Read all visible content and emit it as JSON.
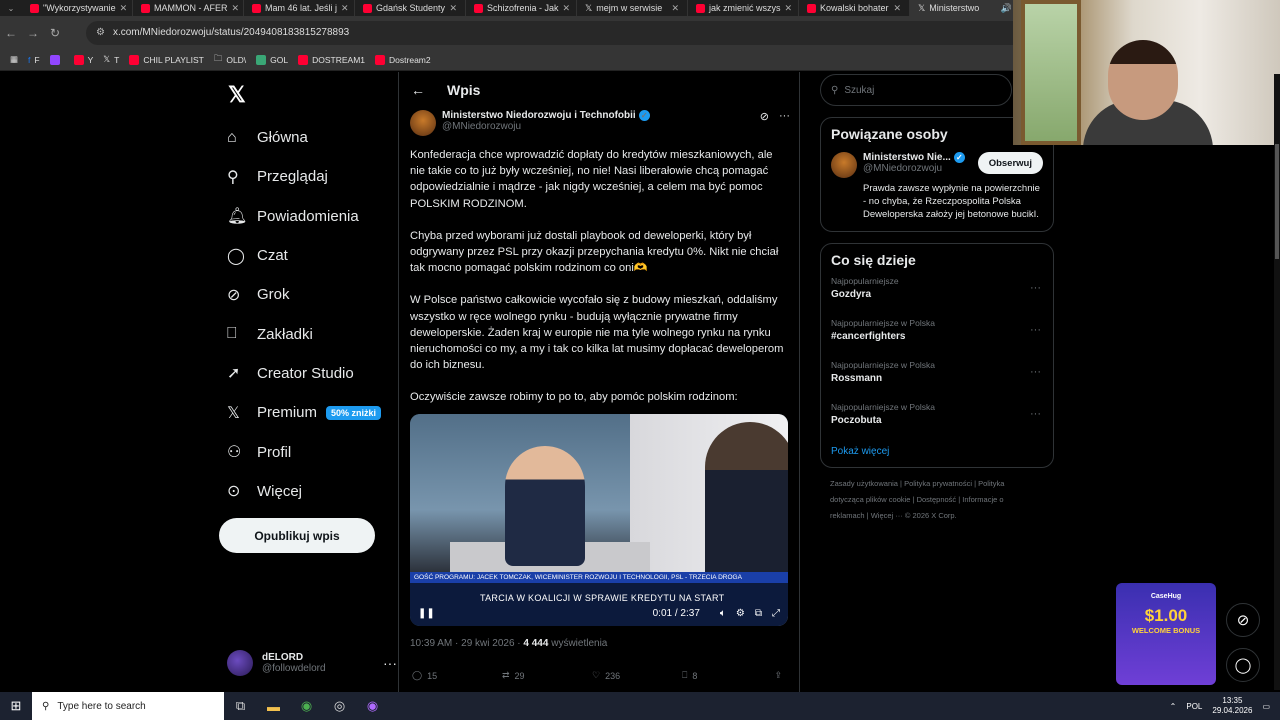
{
  "browser": {
    "tabs": [
      {
        "title": "\"Wykorzystywanie"
      },
      {
        "title": "MAMMON - AFER"
      },
      {
        "title": "Mam 46 lat. Jeśli j"
      },
      {
        "title": "Gdańsk Studenty"
      },
      {
        "title": "Schizofrenia - Jak"
      },
      {
        "title": "mejm w serwisie"
      },
      {
        "title": "jak zmienić wszys"
      },
      {
        "title": "Kowalski bohater"
      },
      {
        "title": "Ministerstwo"
      }
    ],
    "url": "x.com/MNiedorozwoju/status/2049408183815278893",
    "bookmarks": [
      "F",
      "",
      "Y",
      "T",
      "CHIL PLAYLIST",
      "OLD\\",
      "GOL",
      "DOSTREAM1",
      "Dostream2"
    ]
  },
  "sidebar": {
    "items": [
      {
        "label": "Główna"
      },
      {
        "label": "Przeglądaj"
      },
      {
        "label": "Powiadomienia"
      },
      {
        "label": "Czat"
      },
      {
        "label": "Grok"
      },
      {
        "label": "Zakładki"
      },
      {
        "label": "Creator Studio"
      },
      {
        "label": "Premium"
      },
      {
        "label": "Profil"
      },
      {
        "label": "Więcej"
      }
    ],
    "premium_badge": "50% zniżki",
    "post_button": "Opublikuj wpis",
    "account": {
      "name": "dELORD",
      "handle": "@followdelord"
    }
  },
  "post": {
    "header": "Wpis",
    "author_name": "Ministerstwo Niedorozwoju i Technofobii",
    "author_handle": "@MNiedorozwoju",
    "paragraphs": [
      "Konfederacja chce wprowadzić dopłaty do kredytów mieszkaniowych, ale nie takie co to już były wcześniej, no nie! Nasi liberałowie chcą pomagać odpowiedzialnie i mądrze - jak nigdy wcześniej, a celem ma być pomoc POLSKIM RODZINOM.",
      "Chyba przed wyborami już dostali playbook od deweloperki, który był odgrywany przez PSL przy okazji przepychania kredytu 0%. Nikt nie chciał tak mocno pomagać polskim rodzinom co oni🫶",
      "W Polsce państwo całkowicie wycofało się z budowy mieszkań, oddaliśmy wszystko w ręce wolnego rynku - budują wyłącznie prywatne firmy deweloperskie. Żaden kraj w europie nie ma tyle wolnego rynku na rynku nieruchomości co my, a my i tak co kilka lat musimy dopłacać deweloperom do ich biznesu.",
      "Oczywiście zawsze robimy to po to, aby pomóc polskim rodzinom:"
    ],
    "video": {
      "chyron": "GOŚĆ PROGRAMU: JACEK TOMCZAK, WICEMINISTER ROZWOJU I TECHNOLOGII, PSL - TRZECIA DROGA",
      "ticker": "TARCIA W KOALICJI W SPRAWIE KREDYTU NA START",
      "time": "0:01 / 2:37"
    },
    "meta_time": "10:39 AM · 29 kwi 2026 · ",
    "views": "4 444",
    "views_label": " wyświetlenia",
    "stats": {
      "replies": "15",
      "reposts": "29",
      "likes": "236",
      "bookmarks": "8"
    }
  },
  "right": {
    "search_placeholder": "Szukaj",
    "related": {
      "title": "Powiązane osoby",
      "name": "Ministerstwo Nie...",
      "handle": "@MNiedorozwoju",
      "follow": "Obserwuj",
      "bio": "Prawda zawsze wypłynie na powierzchnie - no chyba, że Rzeczpospolita Polska Deweloperska założy jej betonowe bucikI."
    },
    "trends": {
      "title": "Co się dzieje",
      "items": [
        {
          "cat": "Najpopularniejsze",
          "name": "Gozdyra"
        },
        {
          "cat": "Najpopularniejsze w Polska",
          "name": "#cancerfighters"
        },
        {
          "cat": "Najpopularniejsze w Polska",
          "name": "Rossmann"
        },
        {
          "cat": "Najpopularniejsze w Polska",
          "name": "Poczobuta"
        }
      ],
      "show_more": "Pokaż więcej"
    },
    "footer": "Zasady użytkowania | Polityka prywatności | Polityka dotycząca plików cookie | Dostępność | Informacje o reklamach | Więcej ··· © 2026 X Corp."
  },
  "ad": {
    "brand": "CaseHug",
    "amount": "$1.00",
    "text": "WELCOME BONUS"
  },
  "taskbar": {
    "search": "Type here to search",
    "lang": "POL",
    "time": "13:35",
    "date": "29.04.2026"
  }
}
